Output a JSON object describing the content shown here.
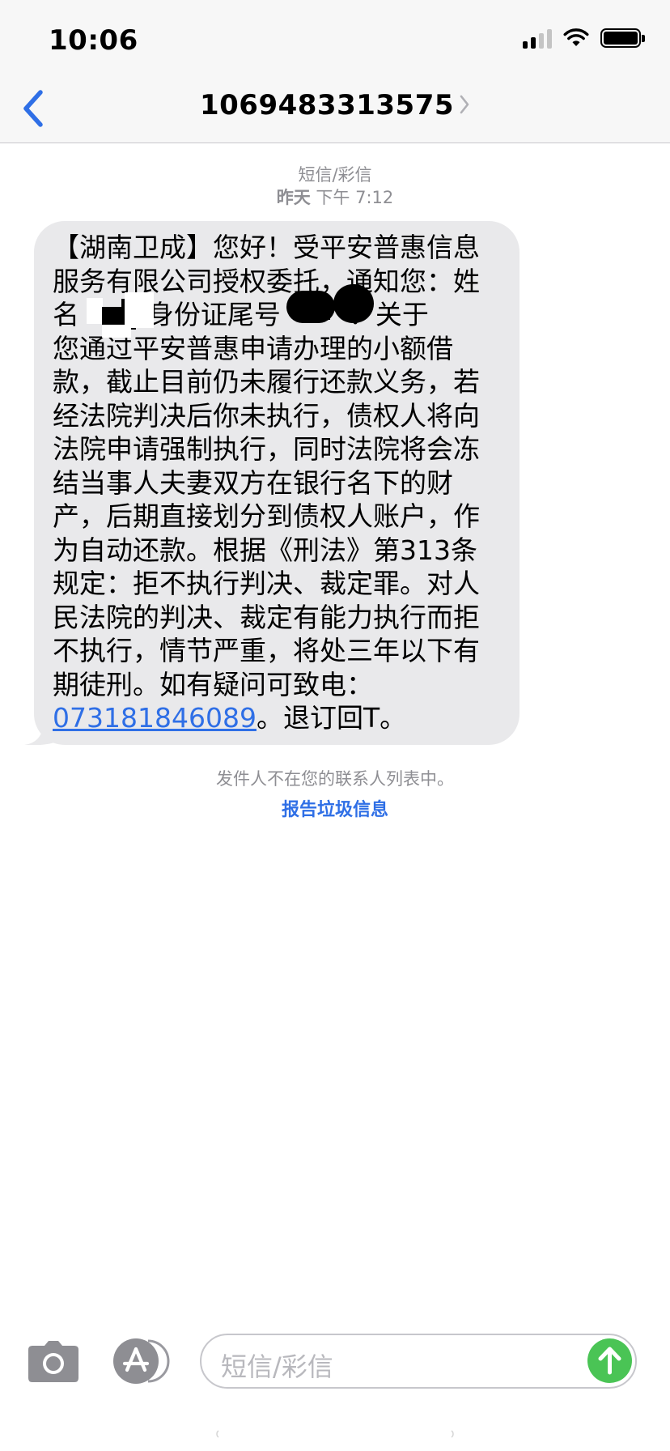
{
  "status_bar": {
    "time": "10:06"
  },
  "nav": {
    "title": "1069483313575"
  },
  "message_meta": {
    "type": "短信/彩信",
    "day": "昨天",
    "time": "下午 7:12"
  },
  "message": {
    "lines": [
      "【湖南卫成】您好！受平安普惠信息",
      "服务有限公司授权委托，通知您：姓",
      "名        身份证尾号        ：关于",
      "您通过平安普惠申请办理的小额借",
      "款，截止目前仍未履行还款义务，若",
      "经法院判决后你未执行，债权人将向",
      "法院申请强制执行，同时法院将会冻",
      "结当事人夫妻双方在银行名下的财",
      "产，后期直接划分到债权人账户，作",
      "为自动还款。根据《刑法》第313条",
      "规定：拒不执行判决、裁定罪。对人",
      "民法院的判决、裁定有能力执行而拒",
      "不执行，情节严重，将处三年以下有",
      "期徒刑。如有疑问可致电："
    ],
    "phone_link": "073181846089",
    "last_line_suffix": "。退订回T。"
  },
  "notice": {
    "text": "发件人不在您的联系人列表中。",
    "report_link": "报告垃圾信息"
  },
  "compose": {
    "placeholder": "短信/彩信"
  },
  "colors": {
    "accent": "#2f6fe6",
    "bubble": "#e9e9eb",
    "send": "#4ac455",
    "meta": "#8e8e93"
  },
  "icons": {
    "back": "chevron-left-icon",
    "details": "chevron-right-icon",
    "camera": "camera-icon",
    "app_store": "app-store-icon",
    "send": "arrow-up-icon"
  }
}
